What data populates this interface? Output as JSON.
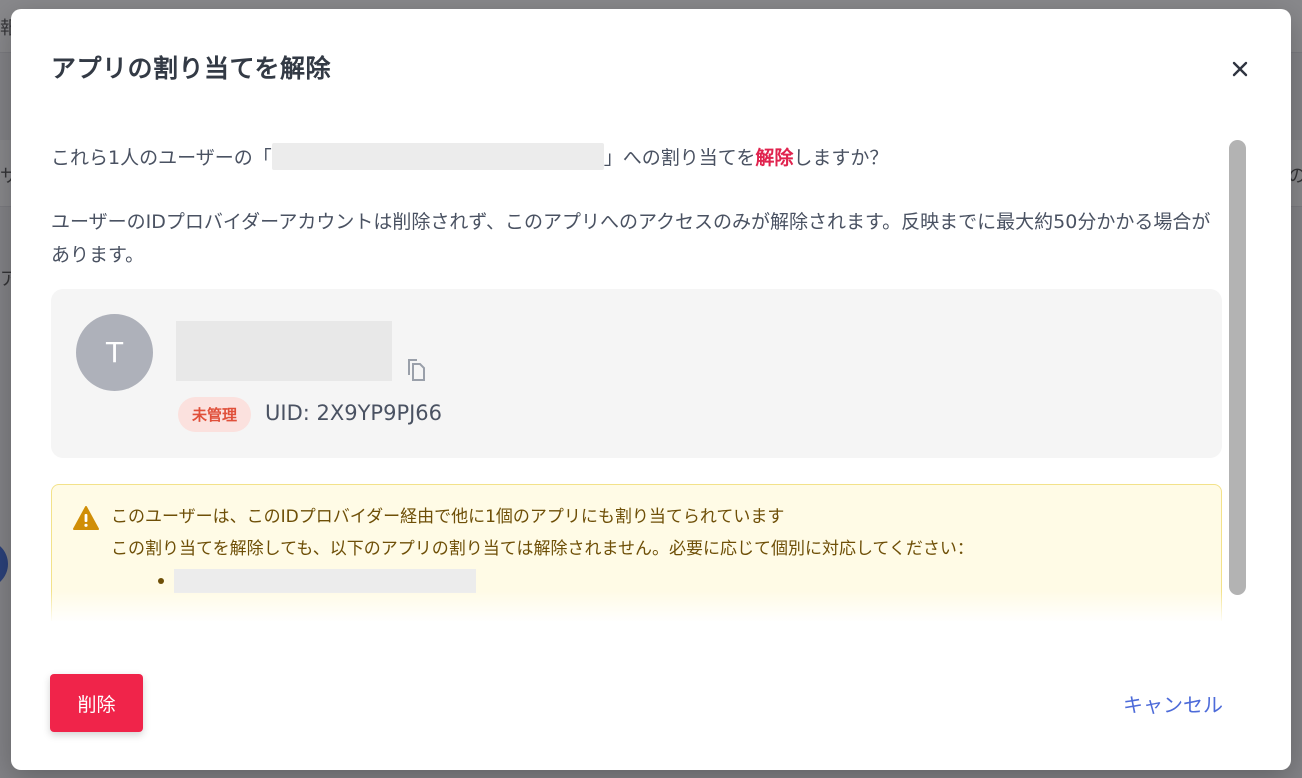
{
  "background": {
    "left_glyphs": [
      "報",
      "サ",
      "ア"
    ],
    "right_glyph": "の"
  },
  "modal": {
    "title": "アプリの割り当てを解除",
    "close_icon": "close-icon",
    "question": {
      "prefix": "これら1人のユーザーの「",
      "suffix_before_action": "」への割り当てを",
      "action_word": "解除",
      "suffix": "しますか？"
    },
    "note": "ユーザーのIDプロバイダーアカウントは削除されず、このアプリへのアクセスのみが解除されます。反映までに最大約50分かかる場合があります。",
    "user": {
      "avatar_initial": "T",
      "copy_icon": "copy-icon",
      "status_badge": "未管理",
      "uid": "UID: 2X9YP9PJ66"
    },
    "warning": {
      "icon": "warning-triangle-icon",
      "line1": "このユーザーは、このIDプロバイダー経由で他に1個のアプリにも割り当てられています",
      "line2": "この割り当てを解除しても、以下のアプリの割り当ては解除されません。必要に応じて個別に対応してください："
    },
    "delete_label": "削除",
    "cancel_label": "キャンセル"
  },
  "colors": {
    "danger": "#f0244a",
    "link": "#4d6bd9",
    "warning_bg": "#fffbe6",
    "warning_text": "#6e4f07",
    "badge_bg": "#fbe1de",
    "badge_text": "#e0503a"
  }
}
